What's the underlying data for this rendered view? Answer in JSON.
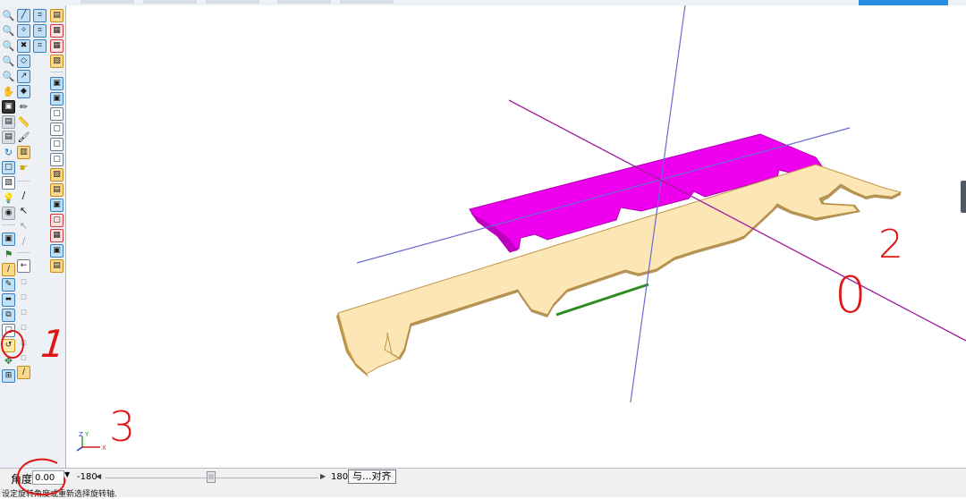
{
  "viewport": {
    "axis_triad": {
      "x": "X",
      "y": "Y",
      "z": "Z"
    },
    "colors": {
      "upper_part": "#ee00ee",
      "lower_part": "#fce6b6",
      "edge": "#bf9748",
      "highlight_edge": "#2d8b20",
      "axis_blue": "#6a6ad0",
      "axis_purple": "#a01a9e"
    }
  },
  "toolbox": {
    "icons": [
      "zoom-in-icon",
      "zoom-out-icon",
      "zoom-window-icon",
      "zoom-all-icon",
      "zoom-previous-icon",
      "pan-hand-icon",
      "camera-icon",
      "pencil-icon",
      "ruler-icon",
      "brush-icon",
      "rotate-view-icon",
      "rectangle-view-icon",
      "cube-view-icon",
      "light-bulb-icon",
      "eye-icon",
      "select-part-icon",
      "rotate-part-icon"
    ]
  },
  "angle_bar": {
    "label": "角度:",
    "value": "0.00",
    "min_label": "-180",
    "max_label": "180",
    "align_button": "与...对齐"
  },
  "status_bar": {
    "text": "设定旋转角度或重新选择旋转轴."
  },
  "annotations": {
    "one": "1",
    "two": "2",
    "zero": "0",
    "three": "3",
    "color": "#e01515"
  }
}
